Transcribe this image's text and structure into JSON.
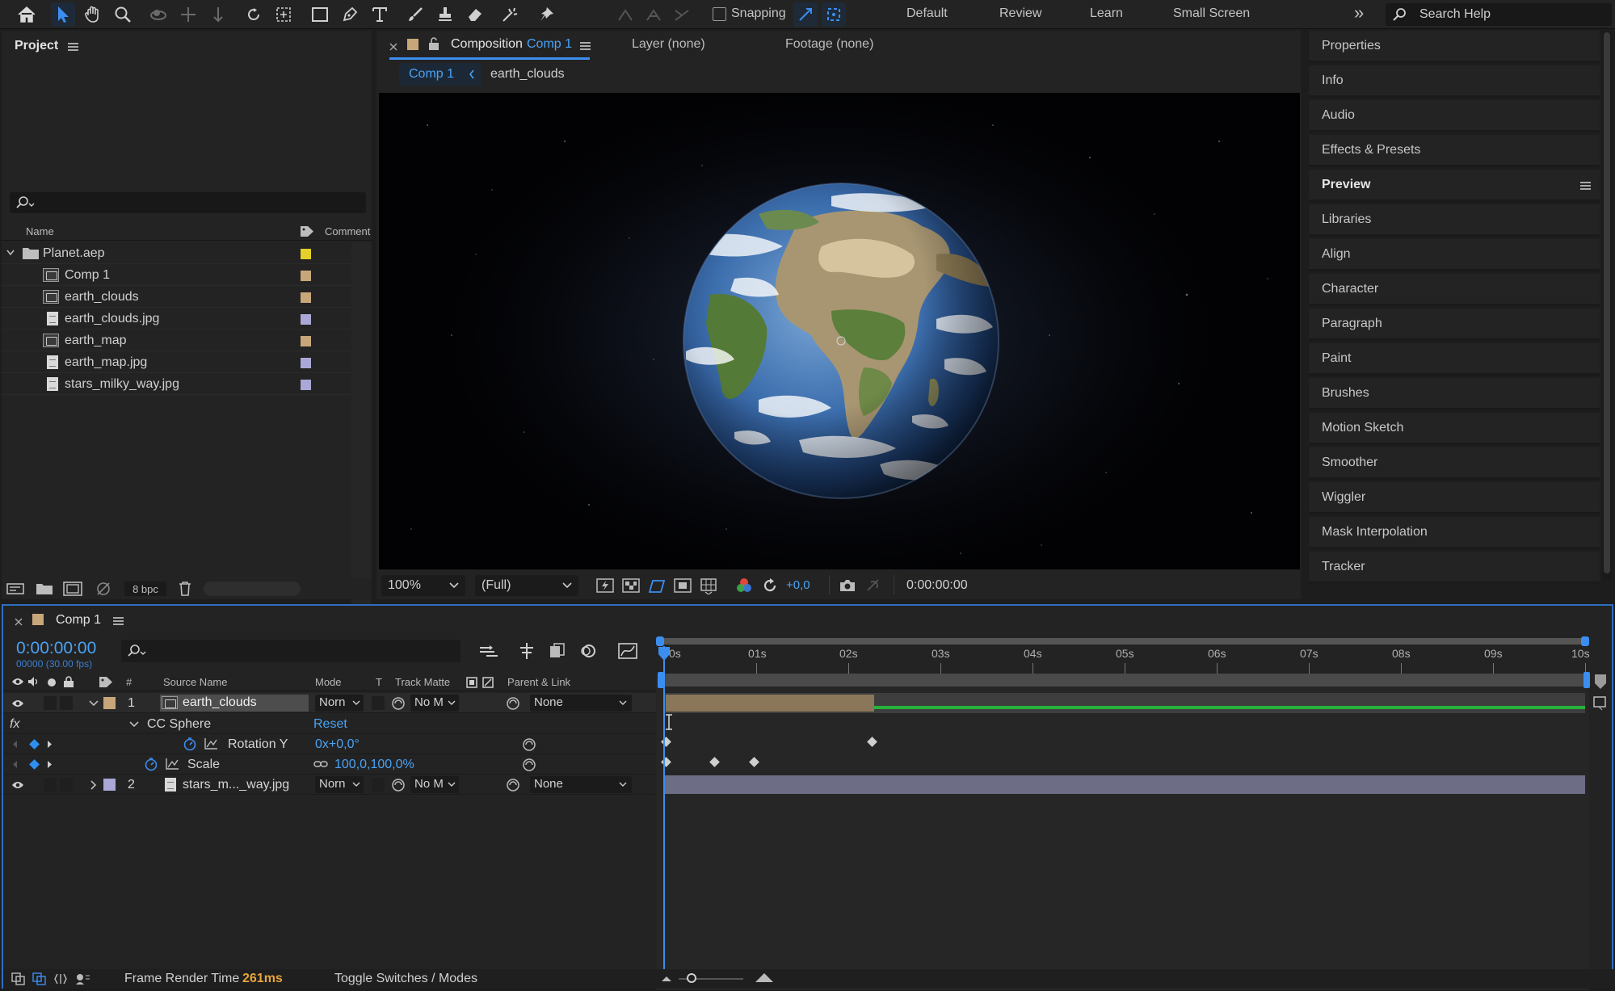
{
  "toolbar": {
    "tools": [
      "home-icon",
      "selection-tool-icon",
      "hand-tool-icon",
      "zoom-tool-icon",
      "orbit-camera-icon",
      "pan-camera-icon",
      "dolly-camera-icon",
      "rotate-tool-icon",
      "pan-behind-icon",
      "rectangle-tool-icon",
      "pen-tool-icon",
      "type-tool-icon",
      "brush-tool-icon",
      "clone-stamp-icon",
      "eraser-tool-icon",
      "roto-brush-icon",
      "puppet-pin-icon"
    ],
    "snapping_label": "Snapping",
    "workspaces": [
      "Default",
      "Review",
      "Learn",
      "Small Screen"
    ],
    "overflow": "»",
    "search_placeholder": "Search Help"
  },
  "project": {
    "title": "Project",
    "columns": {
      "name": "Name",
      "comment": "Comment"
    },
    "items": [
      {
        "name": "Planet.aep",
        "type": "folder",
        "color": "#e6cf2a"
      },
      {
        "name": "Comp 1",
        "type": "comp",
        "color": "#c7a77a"
      },
      {
        "name": "earth_clouds",
        "type": "comp",
        "color": "#c7a77a"
      },
      {
        "name": "earth_clouds.jpg",
        "type": "file",
        "color": "#a9a8d6"
      },
      {
        "name": "earth_map",
        "type": "comp",
        "color": "#c7a77a"
      },
      {
        "name": "earth_map.jpg",
        "type": "file",
        "color": "#a9a8d6"
      },
      {
        "name": "stars_milky_way.jpg",
        "type": "file",
        "color": "#a9a8d6"
      }
    ],
    "footer_bpc": "8 bpc"
  },
  "composition": {
    "tab_prefix": "Composition",
    "tab_name": "Comp 1",
    "layer_tab": "Layer (none)",
    "footage_tab": "Footage (none)",
    "breadcrumbs": [
      "Comp 1",
      "earth_clouds"
    ],
    "zoom": "100%",
    "resolution": "(Full)",
    "exposure": "+0,0",
    "timecode": "0:00:00:00"
  },
  "right_panels": [
    "Properties",
    "Info",
    "Audio",
    "Effects & Presets",
    "Preview",
    "Libraries",
    "Align",
    "Character",
    "Paragraph",
    "Paint",
    "Brushes",
    "Motion Sketch",
    "Smoother",
    "Wiggler",
    "Mask Interpolation",
    "Tracker"
  ],
  "timeline": {
    "comp_name": "Comp 1",
    "current_time": "0:00:00:00",
    "frames_fps": "00000 (30.00 fps)",
    "columns": {
      "num": "#",
      "source": "Source Name",
      "mode": "Mode",
      "t": "T",
      "matte": "Track Matte",
      "parent": "Parent & Link"
    },
    "layers": [
      {
        "num": "1",
        "name": "earth_clouds",
        "mode": "Norn",
        "matte": "No M",
        "parent": "None",
        "color": "#c7a77a"
      },
      {
        "num": "2",
        "name": "stars_m..._way.jpg",
        "mode": "Norn",
        "matte": "No M",
        "parent": "None",
        "color": "#a9a8d6"
      }
    ],
    "effect": {
      "fx": "fx",
      "name": "CC Sphere",
      "reset": "Reset"
    },
    "props": [
      {
        "name": "Rotation Y",
        "value": "0x+0,0°"
      },
      {
        "name": "Scale",
        "value": "100,0,100,0%"
      }
    ],
    "ruler": [
      "0s",
      "01s",
      "02s",
      "03s",
      "04s",
      "05s",
      "06s",
      "07s",
      "08s",
      "09s",
      "10s"
    ],
    "footer": {
      "render_label": "Frame Render Time",
      "render_value": "261ms",
      "toggle": "Toggle Switches / Modes"
    }
  }
}
